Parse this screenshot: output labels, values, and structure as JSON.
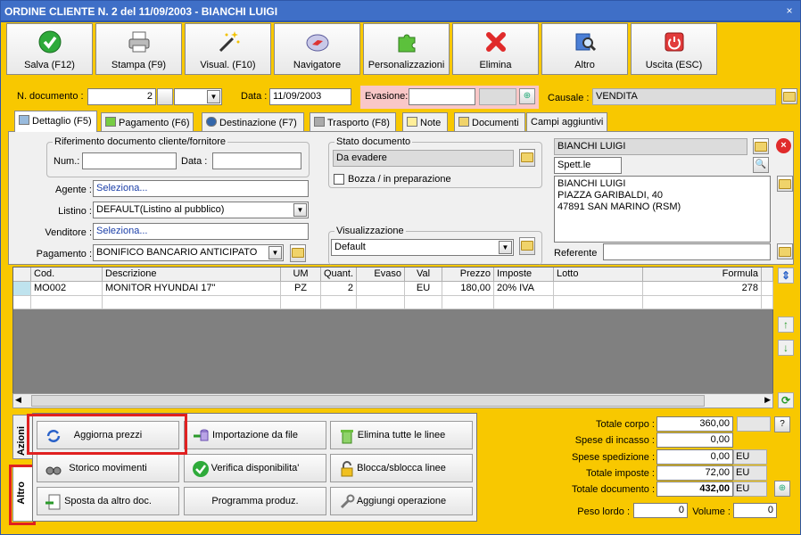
{
  "window": {
    "title": "ORDINE CLIENTE N. 2 del 11/09/2003 - BIANCHI LUIGI",
    "close": "×"
  },
  "toolbar": [
    {
      "label": "Salva (F12)",
      "icon": "check-icon"
    },
    {
      "label": "Stampa (F9)",
      "icon": "printer-icon"
    },
    {
      "label": "Visual. (F10)",
      "icon": "magic-wand-icon"
    },
    {
      "label": "Navigatore",
      "icon": "compass-icon"
    },
    {
      "label": "Personalizzazioni",
      "icon": "puzzle-icon"
    },
    {
      "label": "Elimina",
      "icon": "delete-x-icon"
    },
    {
      "label": "Altro",
      "icon": "book-search-icon"
    },
    {
      "label": "Uscita (ESC)",
      "icon": "power-icon"
    }
  ],
  "header": {
    "doc_number_label": "N. documento :",
    "doc_number": "2",
    "date_label": "Data :",
    "date": "11/09/2003",
    "evasione_label": "Evasione:",
    "causale_label": "Causale :",
    "causale": "VENDITA"
  },
  "tabs": [
    "Dettaglio (F5)",
    "Pagamento (F6)",
    "Destinazione (F7)",
    "Trasporto (F8)",
    "Note",
    "Documenti",
    "Campi aggiuntivi"
  ],
  "detail": {
    "rif_group": "Riferimento documento cliente/fornitore",
    "num_label": "Num.:",
    "data_label": "Data :",
    "agente_label": "Agente :",
    "agente": "Seleziona...",
    "listino_label": "Listino :",
    "listino": "DEFAULT(Listino al pubblico)",
    "venditore_label": "Venditore :",
    "venditore": "Seleziona...",
    "pagamento_label": "Pagamento :",
    "pagamento": "BONIFICO BANCARIO ANTICIPATO",
    "stato_group": "Stato documento",
    "stato": "Da evadere",
    "bozza_label": "Bozza / in preparazione",
    "visual_group": "Visualizzazione",
    "visual": "Default",
    "customer_name": "BIANCHI LUIGI",
    "salutation": "Spett.le",
    "address_lines": [
      "BIANCHI LUIGI",
      "PIAZZA GARIBALDI, 40",
      "47891 SAN MARINO (RSM)"
    ],
    "referente_label": "Referente"
  },
  "grid": {
    "columns": [
      "Cod.",
      "Descrizione",
      "UM",
      "Quant.",
      "Evaso",
      "Val",
      "Prezzo",
      "Imposte",
      "Lotto",
      "Formula"
    ],
    "rows": [
      [
        "MO002",
        "MONITOR HYUNDAI 17\"",
        "PZ",
        "2",
        "",
        "EU",
        "180,00",
        "20% IVA",
        "",
        "278"
      ]
    ]
  },
  "side_tabs": [
    "Azioni",
    "Altro"
  ],
  "actions": [
    [
      "Aggiorna prezzi",
      "Importazione da file",
      "Elimina tutte le linee"
    ],
    [
      "Storico movimenti",
      "Verifica disponibilita'",
      "Blocca/sblocca linee"
    ],
    [
      "Sposta da altro doc.",
      "Programma produz.",
      "Aggiungi operazione"
    ]
  ],
  "totals": {
    "corpo_label": "Totale corpo :",
    "corpo": "360,00",
    "help": "?",
    "incasso_label": "Spese di incasso :",
    "incasso": "0,00",
    "spedizione_label": "Spese spedizione :",
    "spedizione": "0,00",
    "imposte_label": "Totale imposte :",
    "imposte": "72,00",
    "documento_label": "Totale documento :",
    "documento": "432,00",
    "currency": "EU",
    "peso_label": "Peso lordo :",
    "peso": "0",
    "volume_label": "Volume :",
    "volume": "0"
  }
}
